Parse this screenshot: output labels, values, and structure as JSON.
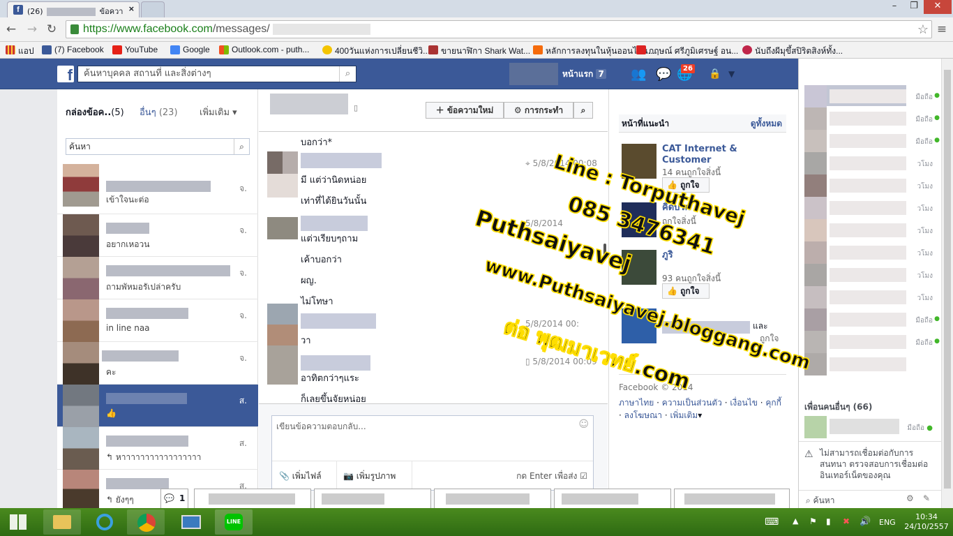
{
  "browser": {
    "tab_title": "(26)",
    "tab_title_suffix": "ข้อควา",
    "tab_close": "×",
    "url_main": "https://www.facebook.com",
    "url_path": "/messages/",
    "bookmarks": [
      {
        "label": "แอป",
        "color": "#c33"
      },
      {
        "label": "(7) Facebook",
        "color": "#3b5998"
      },
      {
        "label": "YouTube",
        "color": "#e62117"
      },
      {
        "label": "Google",
        "color": "#4285f4"
      },
      {
        "label": "Outlook.com - puth...",
        "color": "#f25022"
      },
      {
        "label": "400วันแห่งการเปลี่ยนชีวิ...",
        "color": "#f4c400"
      },
      {
        "label": "ขายนาฬิกา Shark Wat...",
        "color": "#a33"
      },
      {
        "label": "หลักการลงทุนในหุ้นออนไลน...",
        "color": "#f56b0c"
      },
      {
        "label": "กฤษณ์ ศรีภูมิเศรษฐ์ อน...",
        "color": "#d22"
      },
      {
        "label": "นับถึงผีมุขึ้สปิริตสิงห์ทั้ง...",
        "color": "#c0264a"
      }
    ]
  },
  "fb_header": {
    "search_placeholder": "ค้นหาบุคคล สถานที่ และสิ่งต่างๆ",
    "home_label": "หน้าแรก",
    "home_count": "7",
    "notif_count": "26"
  },
  "inbox": {
    "tab_inbox": "กล่องข้อค..",
    "tab_inbox_count": "(5)",
    "tab_other": "อื่นๆ",
    "tab_other_count": "(23)",
    "tab_more": "เพิ่มเติม",
    "search_placeholder": "ค้นหา",
    "conversations": [
      {
        "snippet": "เข้าใจนะต่อ",
        "date": "จ."
      },
      {
        "snippet": "อยากเหอวน",
        "date": "จ."
      },
      {
        "snippet": "ถามพัหมอรัเปล่าครับ",
        "date": "จ."
      },
      {
        "snippet": "in line naa",
        "date": "จ."
      },
      {
        "snippet": "คะ",
        "date": "จ."
      },
      {
        "snippet": "",
        "date": "ส."
      },
      {
        "snippet": "↰ หาาาาาาาาาาาาาาาาา",
        "date": "ส."
      },
      {
        "snippet": "↰ ยังๆๆ",
        "date": "ส."
      }
    ]
  },
  "thread": {
    "new_message_label": "ข้อความใหม่",
    "actions_label": "การกระทำ",
    "messages": [
      {
        "text": "บอกว่า*"
      },
      {
        "text": "มี แต่ว่านิดหน่อย"
      },
      {
        "text": "เท่าที่ได้ยินวันนั้น"
      },
      {
        "text": "แต่วเรียบๆถาม"
      },
      {
        "text": "เค้าบอกว่า"
      },
      {
        "text": "ผญ."
      },
      {
        "text": "ไม่โทษา"
      },
      {
        "text": "วา"
      },
      {
        "text": "อาทิตกว่าๆแระ"
      },
      {
        "text": "ก็เลยขึ้นจัยหน่อย"
      }
    ],
    "times": [
      "5/8/2014 00:08",
      "5/8/2014",
      "5/8/2014 00:",
      "5/8/2014 00:09"
    ],
    "reply_placeholder": "เขียนข้อความตอบกลับ...",
    "add_files": "เพิ่มไฟล์",
    "add_photos": "เพิ่มรูปภาพ",
    "press_enter": "กด Enter เพื่อส่ง"
  },
  "suggestions": {
    "header": "หน้าที่แนะนำ",
    "see_all": "ดูทั้งหมด",
    "pages": [
      {
        "name": "CAT Internet & Customer",
        "likes": "14 คนถูกใจสิ่งนี้",
        "img": "#6a5a3c"
      },
      {
        "name": "คิดบวก",
        "likes": "ถูกใจสิ่งนี้",
        "img": "#2b3d6b"
      },
      {
        "name": "ภูริ",
        "likes": "93 คนถูกใจสิ่งนี้",
        "img": "#3c4a3a"
      },
      {
        "name": "และ",
        "likes": "ถูกใจ",
        "img": "#2e5fa8"
      }
    ],
    "like_label": "ถูกใจ",
    "footer_copy": "Facebook © 2014",
    "footer_links": [
      "ภาษาไทย",
      "ความเป็นส่วนตัว",
      "เงื่อนไข",
      "คุกกี้",
      "ลงโฆษณา",
      "เพิ่มเติม"
    ]
  },
  "chat": {
    "statuses": [
      "มือถือ",
      "มือถือ",
      "มือถือ",
      "",
      "",
      "",
      "",
      "",
      "",
      "",
      "",
      "",
      ""
    ],
    "status_labels": [
      "มือถือ",
      "มือถือ",
      "มือถือ",
      "วโมง",
      "วโมง",
      "วโมง",
      "วโมง",
      "วโมง",
      "วโมง",
      "วโมง",
      "มือถือ",
      "มือถือ"
    ],
    "more_friends": "เพื่อนคนอื่นๆ (66)",
    "more_friends_status": "มือถือ",
    "offline_warning": "ไม่สามารถเชื่อมต่อกับการสนทนา ตรวจสอบการเชื่อมต่ออินเทอร์เน็ตของคุณ",
    "search_label": "ค้นหา",
    "tab_count": "1"
  },
  "taskbar": {
    "lang": "ENG",
    "time": "10:34",
    "date": "24/10/2557"
  },
  "watermark": {
    "line1": "Line : Torputhavej",
    "line2": "085 3476341",
    "line3": "Puthsaiyavej",
    "line4": "www.Puthsaiyavej.bloggang.com",
    "line5": "ต่อ พุฒมาเวทย์.com"
  }
}
